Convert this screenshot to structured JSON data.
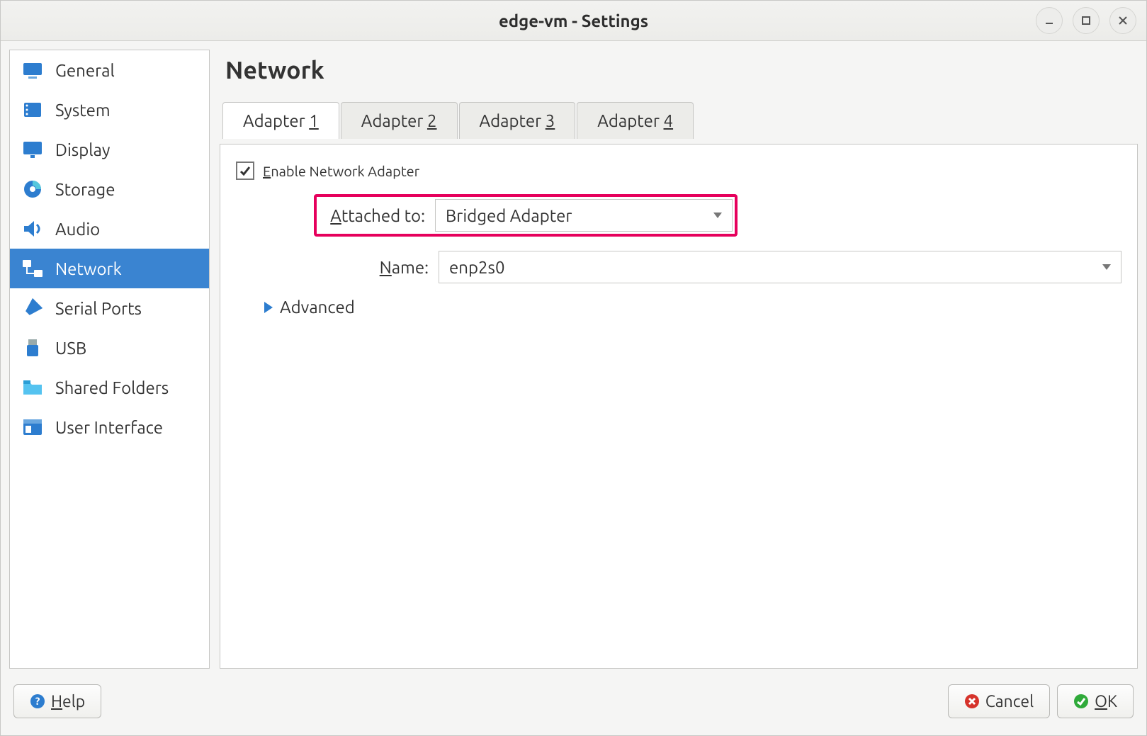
{
  "window": {
    "title": "edge-vm - Settings"
  },
  "sidebar": {
    "items": [
      {
        "label": "General"
      },
      {
        "label": "System"
      },
      {
        "label": "Display"
      },
      {
        "label": "Storage"
      },
      {
        "label": "Audio"
      },
      {
        "label": "Network"
      },
      {
        "label": "Serial Ports"
      },
      {
        "label": "USB"
      },
      {
        "label": "Shared Folders"
      },
      {
        "label": "User Interface"
      }
    ],
    "selected_index": 5
  },
  "page": {
    "title": "Network"
  },
  "tabs": [
    {
      "prefix": "Adapter ",
      "num": "1"
    },
    {
      "prefix": "Adapter ",
      "num": "2"
    },
    {
      "prefix": "Adapter ",
      "num": "3"
    },
    {
      "prefix": "Adapter ",
      "num": "4"
    }
  ],
  "active_tab_index": 0,
  "form": {
    "enable_prefix": "E",
    "enable_rest": "nable Network Adapter",
    "enable_checked": true,
    "attached_prefix": "A",
    "attached_rest": "ttached to:",
    "attached_value": "Bridged Adapter",
    "name_prefix": "N",
    "name_rest": "ame:",
    "name_value": "enp2s0",
    "advanced_prefix": "A",
    "advanced_mid": "d",
    "advanced_rest": "vanced"
  },
  "buttons": {
    "help_prefix": "H",
    "help_rest": "elp",
    "cancel": "Cancel",
    "ok_prefix": "O",
    "ok_rest": "K"
  }
}
